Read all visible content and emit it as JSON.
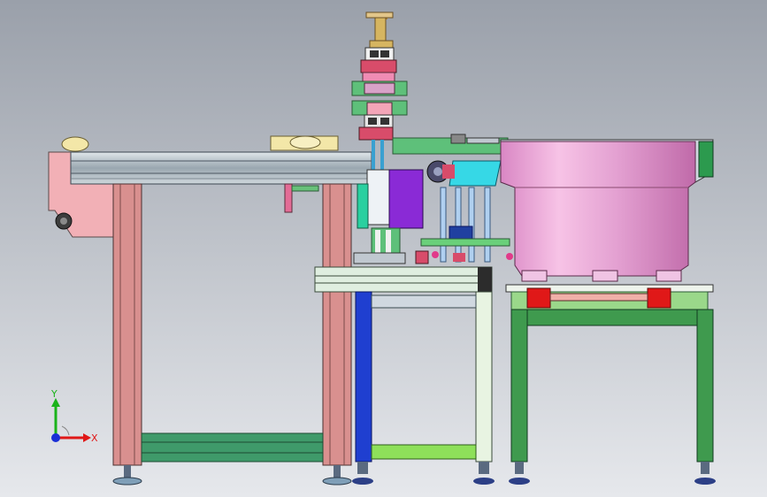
{
  "viewport": {
    "background_top": "#9aa0aa",
    "background_bottom": "#e6e8ec"
  },
  "triad": {
    "y_label": "Y",
    "x_label": "X",
    "y_color": "#1ab31a",
    "x_color": "#e01818",
    "z_color": "#1a2fd6"
  },
  "palette": {
    "rail_gray": "#b8c2c8",
    "pink_plate": "#f2b0b6",
    "leg_pink": "#d9908f",
    "leg_green": "#49a95a",
    "leg_blue": "#1f3fd0",
    "bowl_pink": "#e8a0d0",
    "purple_block": "#8a2ad6",
    "cyan": "#36d8e6",
    "red": "#e01818",
    "gold": "#d6b560",
    "lime": "#8ee05a"
  }
}
